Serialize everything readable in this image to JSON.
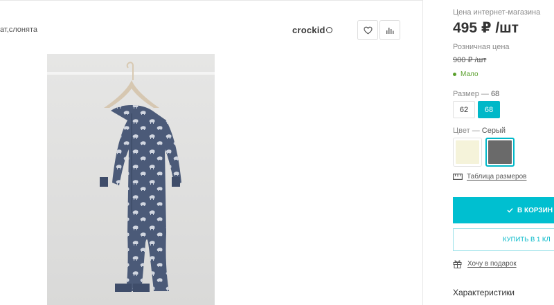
{
  "product": {
    "subtitle": "ат,слонята",
    "brand": "crockid",
    "brand_mark": "®"
  },
  "actions": {
    "favorite_icon": "heart-icon",
    "compare_icon": "bar-chart-icon"
  },
  "pricing": {
    "online_label": "Цена интернет-магазина",
    "price": "495 ₽ /шт",
    "retail_label": "Розничная цена",
    "old_price": "900 ₽ /шт",
    "stock_status": "Мало",
    "stock_color": "#5aa02c"
  },
  "size": {
    "label": "Размер",
    "separator": "—",
    "selected": "68",
    "options": [
      "62",
      "68"
    ]
  },
  "color": {
    "label": "Цвет",
    "separator": "—",
    "selected": "Серый",
    "swatches": [
      "#f5f3da",
      "#6a6a6a"
    ]
  },
  "size_table_link": "Таблица размеров",
  "buttons": {
    "cart": "В КОРЗИН",
    "one_click": "КУПИТЬ В 1 КЛ",
    "accent_color": "#00bfd0"
  },
  "gift_link": "Хочу в подарок",
  "specs_title": "Характеристики"
}
